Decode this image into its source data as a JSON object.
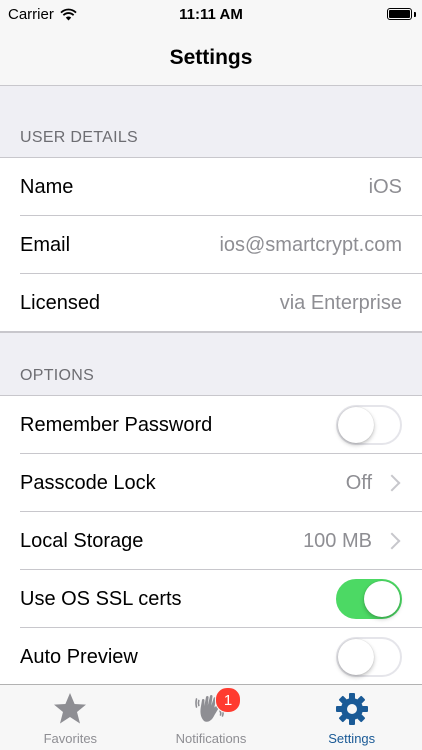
{
  "status_bar": {
    "carrier": "Carrier",
    "time": "11:11 AM"
  },
  "nav": {
    "title": "Settings"
  },
  "sections": {
    "user_details": {
      "header": "USER DETAILS",
      "rows": [
        {
          "label": "Name",
          "value": "iOS"
        },
        {
          "label": "Email",
          "value": "ios@smartcrypt.com"
        },
        {
          "label": "Licensed",
          "value": "via Enterprise"
        }
      ]
    },
    "options": {
      "header": "OPTIONS",
      "remember_password": {
        "label": "Remember Password",
        "enabled": false
      },
      "passcode_lock": {
        "label": "Passcode Lock",
        "value": "Off"
      },
      "local_storage": {
        "label": "Local Storage",
        "value": "100 MB"
      },
      "use_os_ssl": {
        "label": "Use OS SSL certs",
        "enabled": true
      },
      "auto_preview": {
        "label": "Auto Preview",
        "enabled": false
      }
    }
  },
  "tab_bar": {
    "tabs": [
      {
        "label": "Favorites",
        "icon": "star-icon",
        "active": false
      },
      {
        "label": "Notifications",
        "icon": "waving-hand-icon",
        "badge": "1",
        "active": false
      },
      {
        "label": "Settings",
        "icon": "gear-icon",
        "active": true
      }
    ]
  },
  "colors": {
    "toggle_on": "#4cd964",
    "badge": "#ff3b30",
    "tab_active": "#1a5a96",
    "tab_inactive": "#8e8e93",
    "secondary_text": "#8e8e93"
  }
}
